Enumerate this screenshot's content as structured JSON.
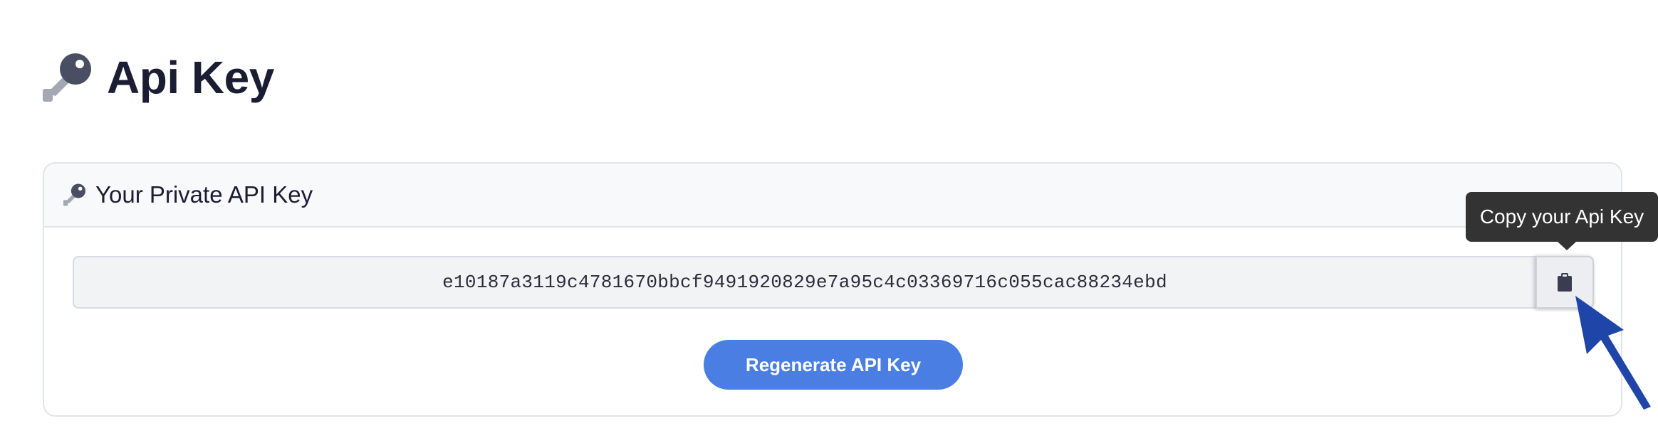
{
  "page": {
    "title": "Api Key",
    "title_icon": "key-icon"
  },
  "card": {
    "title": "Your Private API Key",
    "title_icon": "key-icon",
    "api_key_value": "e10187a3119c4781670bbcf9491920829e7a95c4c03369716c055cac88234ebd",
    "copy_button_icon": "clipboard-icon",
    "copy_tooltip": "Copy your Api Key",
    "regenerate_label": "Regenerate API Key"
  },
  "annotation": {
    "arrow_icon": "pointer-arrow-icon",
    "arrow_color": "#1f45a8"
  },
  "colors": {
    "primary_button": "#4a7ee2",
    "tooltip_bg": "#333333",
    "title_text": "#1b1e33"
  }
}
